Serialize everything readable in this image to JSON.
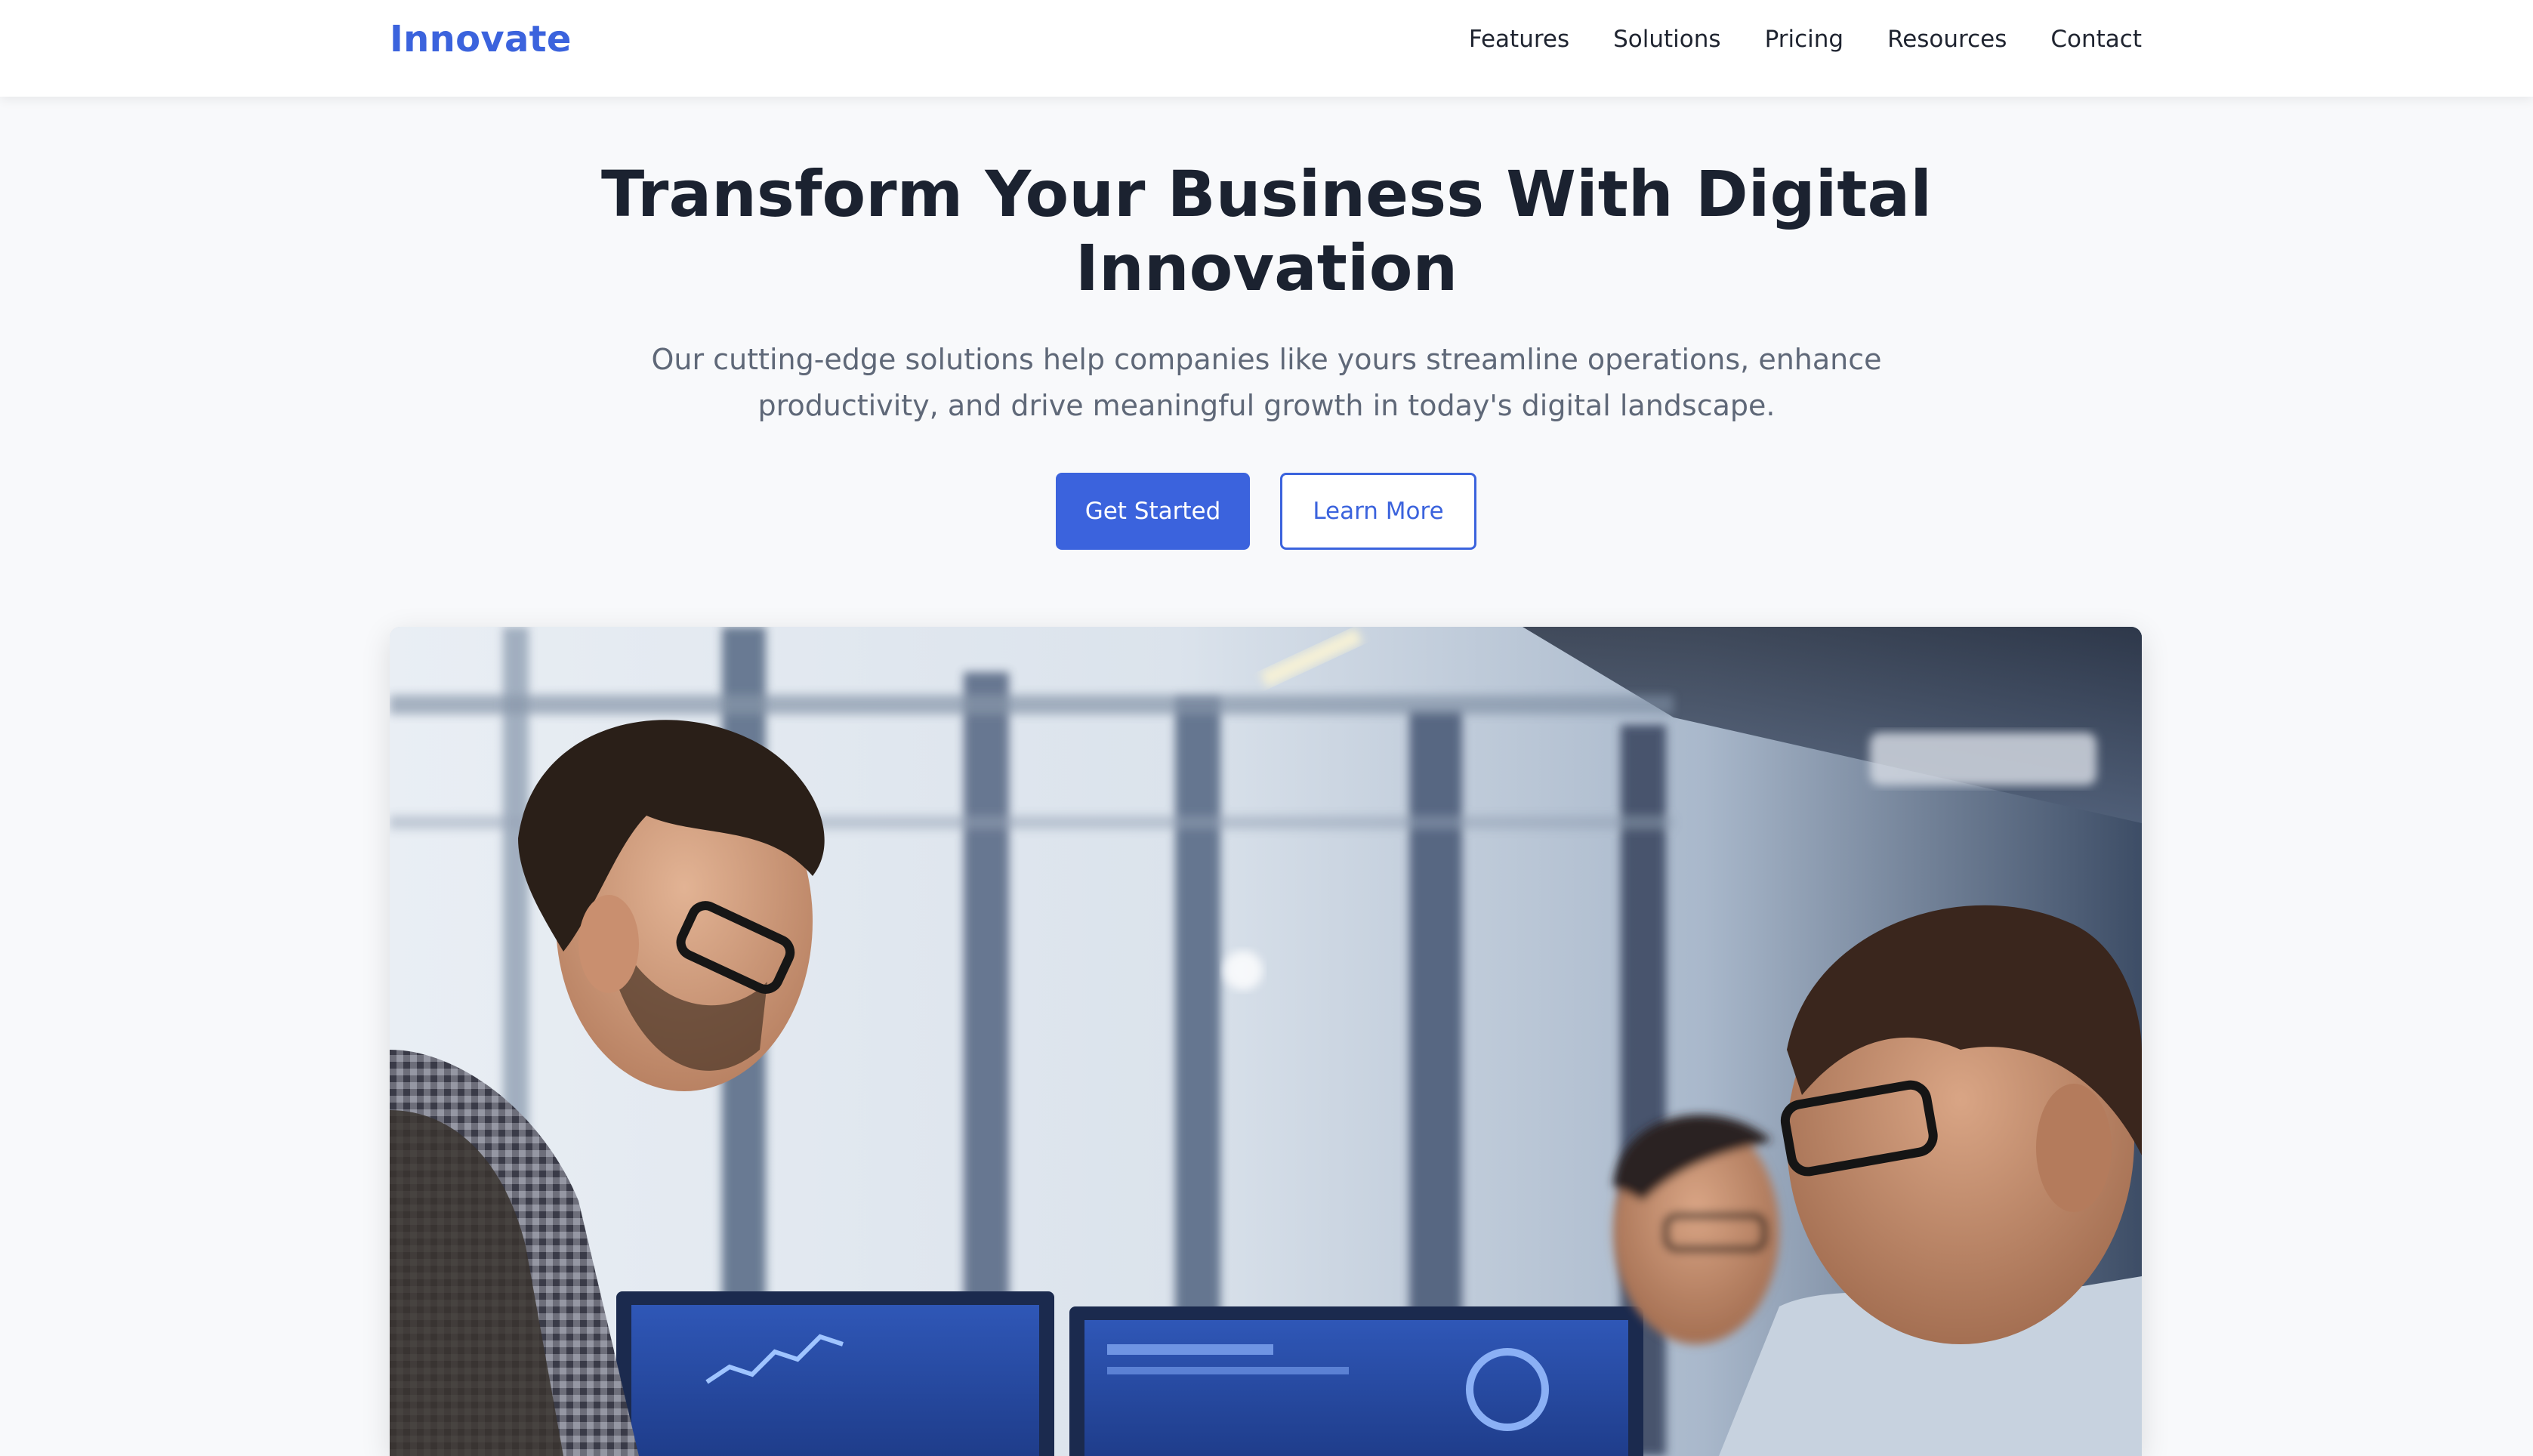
{
  "navbar": {
    "logo": "Innovate",
    "links": [
      "Features",
      "Solutions",
      "Pricing",
      "Resources",
      "Contact"
    ]
  },
  "hero": {
    "title_line1": "Transform Your Business With Digital",
    "title_line2": "Innovation",
    "subtitle_line1": "Our cutting-edge solutions help companies like yours streamline operations, enhance",
    "subtitle_line2": "productivity, and drive meaningful growth in today's digital landscape.",
    "primary_button": "Get Started",
    "secondary_button": "Learn More"
  },
  "colors": {
    "brand": "#3b63dd",
    "heading": "#1b2230",
    "body_text": "#5f6878",
    "page_bg": "#f8f9fb"
  }
}
